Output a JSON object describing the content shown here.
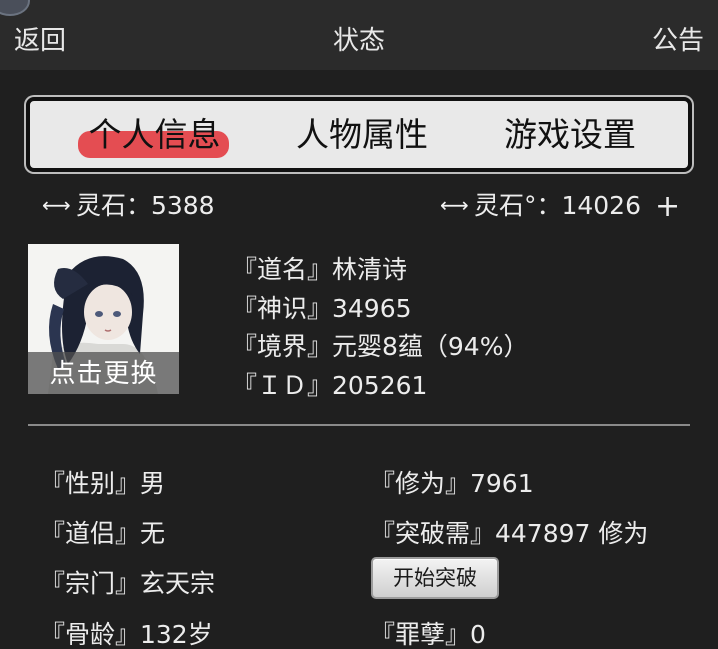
{
  "topbar": {
    "back": "返回",
    "title": "状态",
    "notice": "公告"
  },
  "tabs": [
    {
      "label": "个人信息"
    },
    {
      "label": "人物属性"
    },
    {
      "label": "游戏设置"
    }
  ],
  "currency": {
    "left": "灵石：5388",
    "right": "灵石°：14026"
  },
  "profile": {
    "avatar_label": "点击更换",
    "name": "『道名』林清诗",
    "sense": "『神识』34965",
    "realm": "『境界』元婴8蕴（94%）",
    "id": "『ＩＤ』205261"
  },
  "stats": {
    "gender": "『性别』男",
    "partner": "『道侣』无",
    "sect": "『宗门』玄天宗",
    "age": "『骨龄』132岁",
    "cultivation": "『修为』7961",
    "breakthrough_need": "『突破需』447897 修为",
    "sin": "『罪孽』0"
  },
  "buttons": {
    "start_breakthrough": "开始突破"
  },
  "icons": {
    "currency_arrow": "double-arrow-icon",
    "add": "plus-icon"
  },
  "colors": {
    "tab_highlight": "#e44d52",
    "background": "#1f1f1f",
    "topbar": "#2b2b2b"
  }
}
